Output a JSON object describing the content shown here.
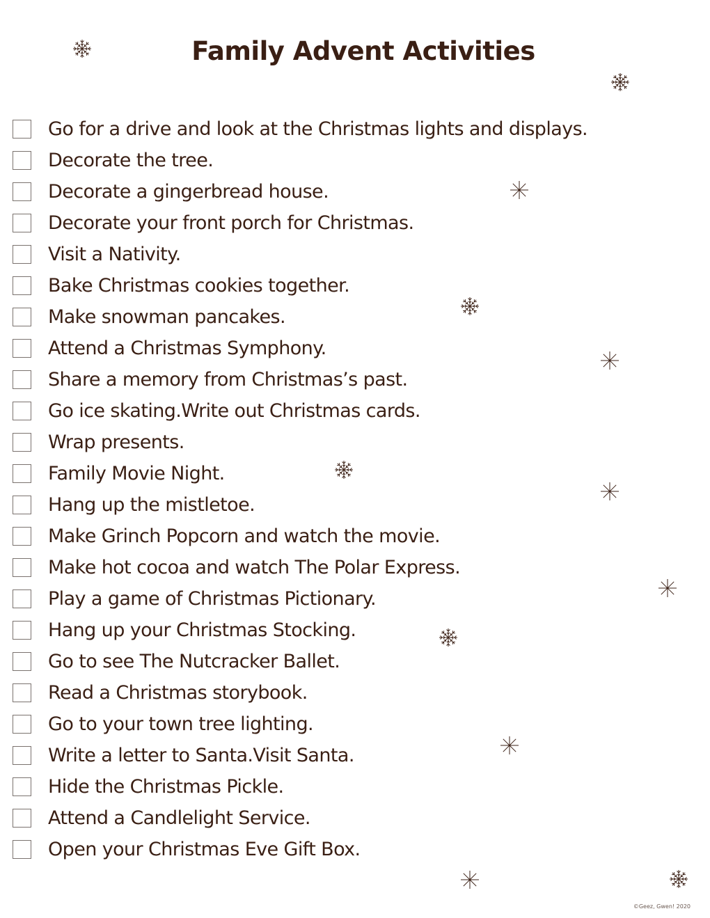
{
  "document": {
    "title": "Family Advent Activities",
    "footer": "©Geez, Gwen! 2020",
    "text_color": "#3a1f14",
    "checkbox_border_color": "#7a726e"
  },
  "activities": [
    {
      "label": "Go for a drive and look at the Christmas lights and displays.",
      "checked": false
    },
    {
      "label": "Decorate the tree.",
      "checked": false
    },
    {
      "label": "Decorate a gingerbread house.",
      "checked": false
    },
    {
      "label": "Decorate your front porch for Christmas.",
      "checked": false
    },
    {
      "label": "Visit a Nativity.",
      "checked": false
    },
    {
      "label": "Bake Christmas cookies together.",
      "checked": false
    },
    {
      "label": "Make snowman pancakes.",
      "checked": false
    },
    {
      "label": "Attend a Christmas Symphony.",
      "checked": false
    },
    {
      "label": "Share a memory from Christmas’s past.",
      "checked": false
    },
    {
      "label": "Go ice skating.Write out Christmas cards.",
      "checked": false
    },
    {
      "label": "Wrap presents.",
      "checked": false
    },
    {
      "label": "Family Movie Night.",
      "checked": false
    },
    {
      "label": "Hang up the mistletoe.",
      "checked": false
    },
    {
      "label": "Make Grinch Popcorn and watch the movie.",
      "checked": false
    },
    {
      "label": "Make hot cocoa and watch The Polar Express.",
      "checked": false
    },
    {
      "label": "Play a game of Christmas Pictionary.",
      "checked": false
    },
    {
      "label": "Hang up your Christmas Stocking.",
      "checked": false
    },
    {
      "label": "Go to see The Nutcracker Ballet.",
      "checked": false
    },
    {
      "label": "Read a Christmas storybook.",
      "checked": false
    },
    {
      "label": "Go to your town tree lighting.",
      "checked": false
    },
    {
      "label": "Write a letter to Santa.Visit Santa.",
      "checked": false
    },
    {
      "label": "Hide the Christmas Pickle.",
      "checked": false
    },
    {
      "label": "Attend a Candlelight Service.",
      "checked": false
    },
    {
      "label": "Open your Christmas Eve Gift Box.",
      "checked": false
    }
  ],
  "decorations": {
    "icon": "snowflake-icon"
  }
}
